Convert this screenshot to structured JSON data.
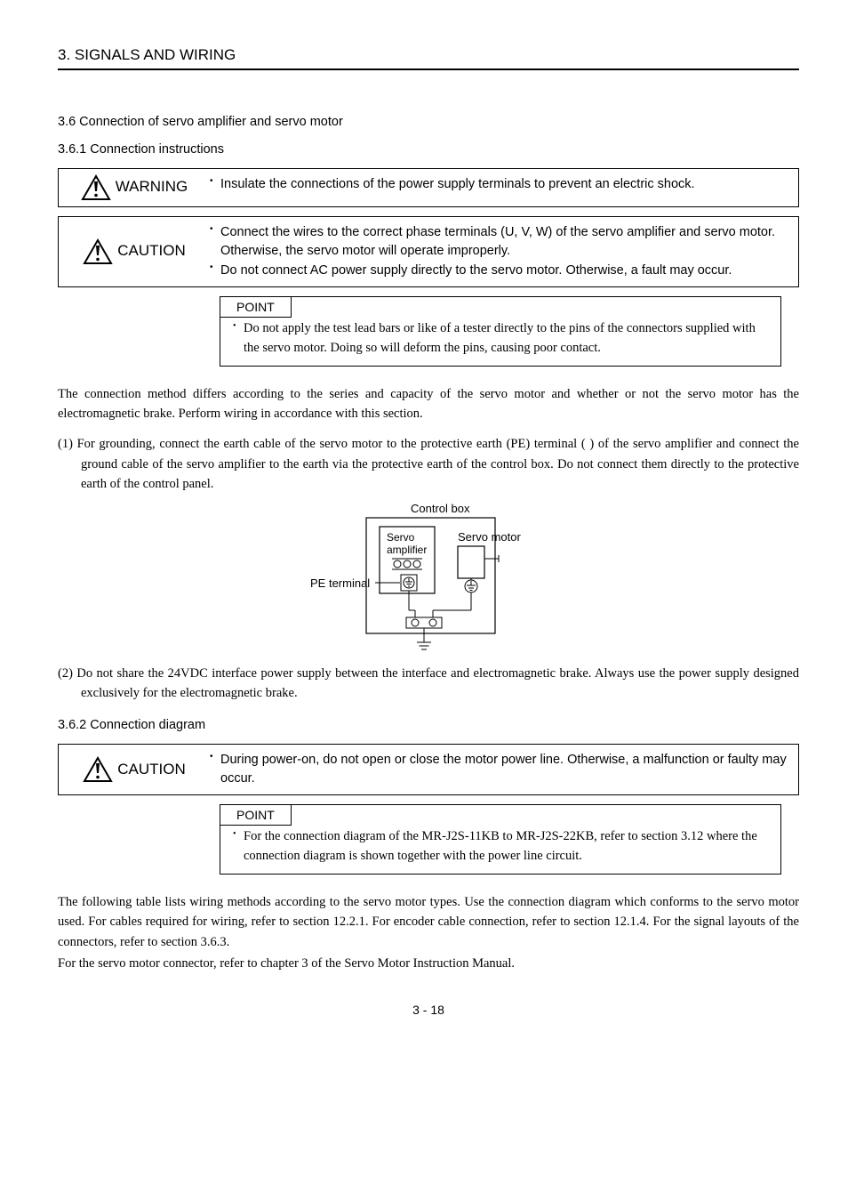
{
  "header": {
    "title": "3. SIGNALS AND WIRING"
  },
  "sec_a": {
    "h1": "3.6 Connection of servo amplifier and servo motor",
    "h2": "3.6.1 Connection instructions"
  },
  "warning": {
    "label": "WARNING",
    "item1": "Insulate the connections of the power supply terminals to prevent an electric shock."
  },
  "caution1": {
    "label": "CAUTION",
    "item1": "Connect the wires to the correct phase terminals (U, V, W) of the servo amplifier and servo motor. Otherwise, the servo motor will operate improperly.",
    "item2": "Do not connect AC power supply directly to the servo motor. Otherwise, a fault may occur."
  },
  "point1": {
    "label": "POINT",
    "text": "Do not apply the test lead bars or like of a tester directly to the pins of the connectors supplied with the servo motor. Doing so will deform the pins, causing poor contact."
  },
  "para1": "The connection method differs according to the series and capacity of the servo motor and whether or not the servo motor has the electromagnetic brake. Perform wiring in accordance with this section.",
  "num1_prefix": "(1) ",
  "num1": "For grounding, connect the earth cable of the servo motor to the protective earth (PE) terminal (    ) of the servo amplifier and connect the ground cable of the servo amplifier to the earth via the protective earth of the control box. Do not connect them directly to the protective earth of the control panel.",
  "chart_data": {
    "type": "diagram",
    "title": "Control box",
    "labels": {
      "outer_box": "Control box",
      "inner_left": "Servo amplifier",
      "inner_right": "Servo motor",
      "left_label": "PE terminal"
    }
  },
  "num2_prefix": "(2) ",
  "num2": "Do not share the 24VDC interface power supply between the interface and electromagnetic brake. Always use the power supply designed exclusively for the electromagnetic brake.",
  "sec_b": {
    "h": "3.6.2 Connection diagram"
  },
  "caution2": {
    "label": "CAUTION",
    "item1": "During power-on, do not open or close the motor power line. Otherwise, a malfunction or faulty may occur."
  },
  "point2": {
    "label": "POINT",
    "text": "For the connection diagram of the MR-J2S-11KB to MR-J2S-22KB, refer to section 3.12 where the connection diagram is shown together with the power line circuit."
  },
  "para2": "The following table lists wiring methods according to the servo motor types. Use the connection diagram which conforms to the servo motor used. For cables required for wiring, refer to section 12.2.1. For encoder cable connection, refer to section 12.1.4. For the signal layouts of the connectors, refer to section 3.6.3.",
  "para3": "For the servo motor connector, refer to chapter 3 of the Servo Motor Instruction Manual.",
  "pagenum": "3 -  18"
}
